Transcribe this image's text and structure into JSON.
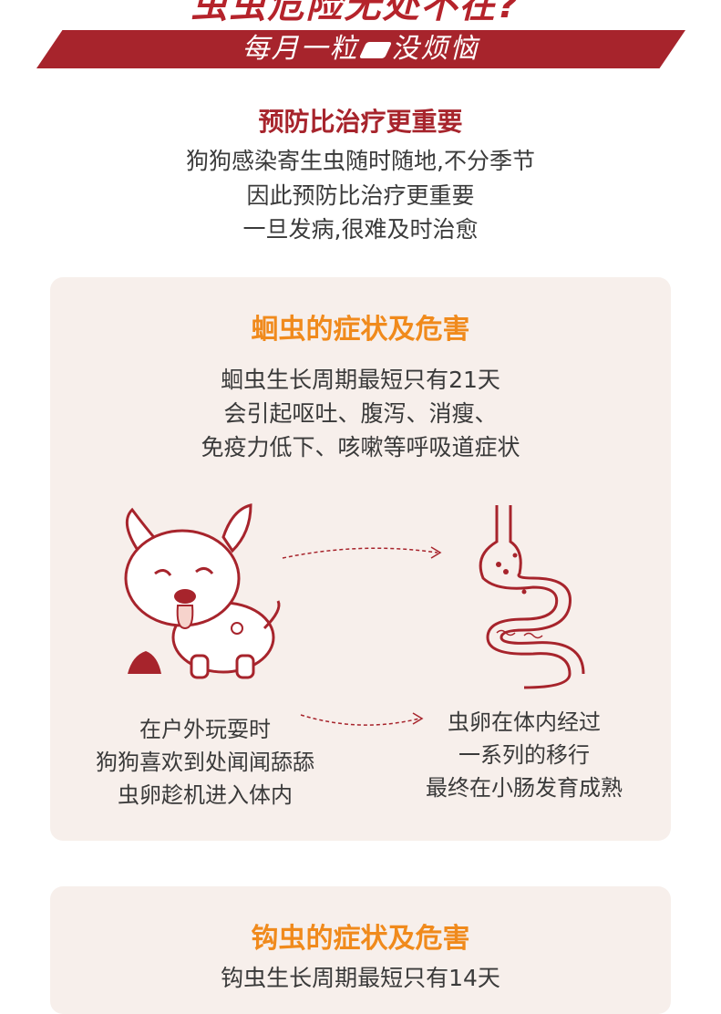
{
  "header": {
    "top_text": "虫虫危险无处不在?",
    "banner_text_left": "每月一粒",
    "banner_text_right": "没烦恼"
  },
  "prevention": {
    "title": "预防比治疗更重要",
    "lines": [
      "狗狗感染寄生虫随时随地,不分季节",
      "因此预防比治疗更重要",
      "一旦发病,很难及时治愈"
    ]
  },
  "roundworm": {
    "title": "蛔虫的症状及危害",
    "lines": [
      "蛔虫生长周期最短只有21天",
      "会引起呕吐、腹泻、消瘦、",
      "免疫力低下、咳嗽等呼吸道症状"
    ],
    "left_caption": [
      "在户外玩耍时",
      "狗狗喜欢到处闻闻舔舔",
      "虫卵趁机进入体内"
    ],
    "right_caption": [
      "虫卵在体内经过",
      "一系列的移行",
      "最终在小肠发育成熟"
    ]
  },
  "hookworm": {
    "title": "钩虫的症状及危害",
    "lines": [
      "钩虫生长周期最短只有14天"
    ]
  },
  "colors": {
    "brand_red": "#a7242c",
    "accent_orange": "#f08a1c",
    "card_bg": "#f7efeb"
  }
}
